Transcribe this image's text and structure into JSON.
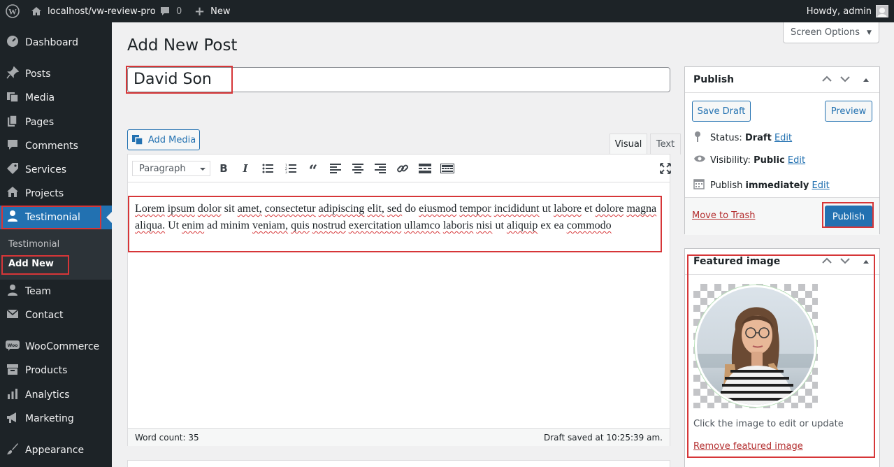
{
  "adminbar": {
    "site_url": "localhost/vw-review-pro",
    "comments_count": "0",
    "new_label": "New",
    "howdy": "Howdy, admin"
  },
  "sidebar": {
    "items": [
      {
        "label": "Dashboard",
        "icon": "dashboard-icon"
      },
      {
        "label": "Posts",
        "icon": "pin-icon"
      },
      {
        "label": "Media",
        "icon": "media-icon"
      },
      {
        "label": "Pages",
        "icon": "pages-icon"
      },
      {
        "label": "Comments",
        "icon": "comment-icon"
      },
      {
        "label": "Services",
        "icon": "tag-icon"
      },
      {
        "label": "Projects",
        "icon": "portfolio-icon"
      },
      {
        "label": "Testimonial",
        "icon": "user-icon"
      },
      {
        "label": "Team",
        "icon": "user-icon"
      },
      {
        "label": "Contact",
        "icon": "mail-icon"
      },
      {
        "label": "WooCommerce",
        "icon": "woo-icon"
      },
      {
        "label": "Products",
        "icon": "archive-icon"
      },
      {
        "label": "Analytics",
        "icon": "chart-icon"
      },
      {
        "label": "Marketing",
        "icon": "megaphone-icon"
      },
      {
        "label": "Appearance",
        "icon": "brush-icon"
      }
    ],
    "submenu": {
      "parent": "Testimonial",
      "current": "Add New"
    }
  },
  "screen_options": "Screen Options",
  "page_title": "Add New Post",
  "post_title_value": "David Son",
  "editor": {
    "add_media": "Add Media",
    "tab_visual": "Visual",
    "tab_text": "Text",
    "format": "Paragraph",
    "content_words": [
      "Lorem",
      "ipsum",
      "dolor",
      "sit",
      "amet,",
      "consectetur",
      "adipiscing",
      "elit,",
      "sed",
      "do",
      "eiusmod",
      "tempor",
      "incididunt",
      "ut",
      "labore",
      "et",
      "dolore",
      "magna",
      "aliqua.",
      "Ut",
      "enim",
      "ad",
      "minim",
      "veniam,",
      "quis",
      "nostrud",
      "exercitation",
      "ullamco",
      "laboris",
      "nisi",
      "ut",
      "aliquip",
      "ex",
      "ea",
      "commodo"
    ],
    "word_count": "Word count: 35",
    "draft_saved": "Draft saved at 10:25:39 am."
  },
  "publish": {
    "title": "Publish",
    "save_draft": "Save Draft",
    "preview": "Preview",
    "status_label": "Status:",
    "status_value": "Draft",
    "visibility_label": "Visibility:",
    "visibility_value": "Public",
    "publish_label": "Publish",
    "publish_value": "immediately",
    "edit": "Edit",
    "move_to_trash": "Move to Trash",
    "publish_button": "Publish"
  },
  "featured_image": {
    "title": "Featured image",
    "hint": "Click the image to edit or update",
    "remove": "Remove featured image"
  },
  "colors": {
    "accent": "#2271b1",
    "highlight": "#d63638",
    "sidebar_bg": "#1d2327"
  }
}
